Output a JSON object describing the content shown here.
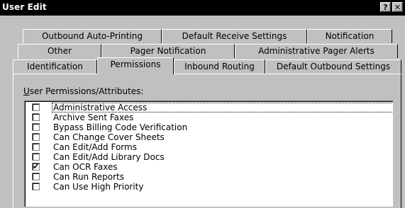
{
  "window": {
    "title": "User Edit",
    "help_label": "?",
    "close_label": "✕"
  },
  "tabs": {
    "row1": [
      "Outbound Auto-Printing",
      "Default Receive Settings",
      "Notification"
    ],
    "row2": [
      "Other",
      "Pager Notification",
      "Administrative Pager Alerts"
    ],
    "row3": [
      "Identification",
      "Permissions",
      "Inbound Routing",
      "Default Outbound Settings"
    ],
    "active": "Permissions"
  },
  "section": {
    "label_mnemonic": "U",
    "label_rest": "ser Permissions/Attributes:"
  },
  "permissions": [
    {
      "label": "Administrative Access",
      "checked": false
    },
    {
      "label": "Archive Sent Faxes",
      "checked": false
    },
    {
      "label": "Bypass Billing Code Verification",
      "checked": false
    },
    {
      "label": "Can Change Cover Sheets",
      "checked": false
    },
    {
      "label": "Can Edit/Add Forms",
      "checked": false
    },
    {
      "label": "Can Edit/Add Library Docs",
      "checked": false
    },
    {
      "label": "Can OCR Faxes",
      "checked": true
    },
    {
      "label": "Can Run Reports",
      "checked": false
    },
    {
      "label": "Can Use High Priority",
      "checked": false
    }
  ]
}
